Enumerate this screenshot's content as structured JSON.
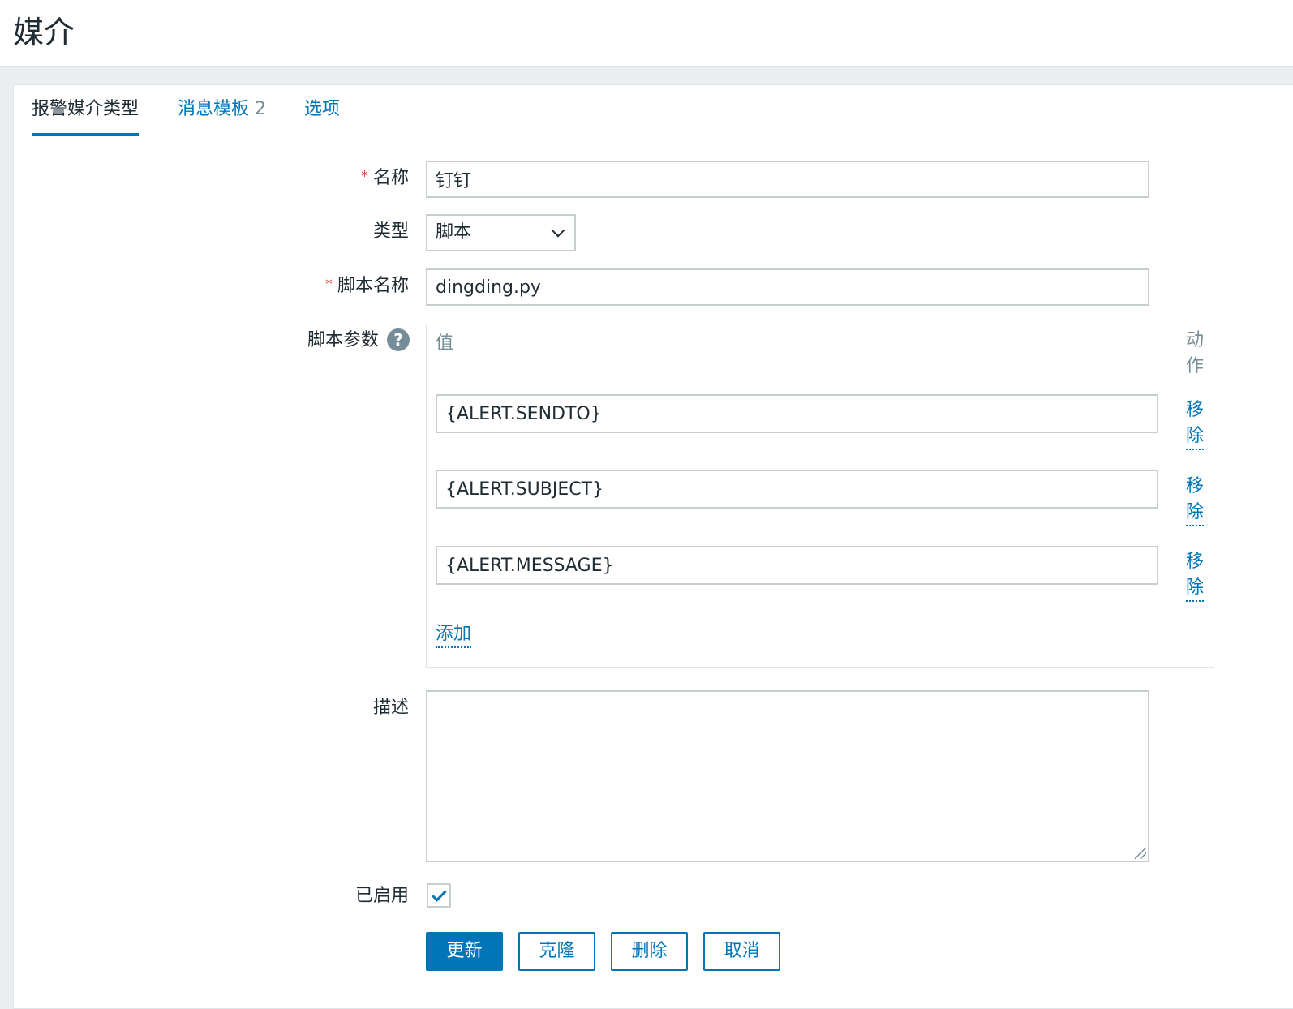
{
  "page": {
    "title": "媒介"
  },
  "tabs": [
    {
      "label": "报警媒介类型",
      "count": ""
    },
    {
      "label": "消息模板",
      "count": "2"
    },
    {
      "label": "选项",
      "count": ""
    }
  ],
  "form": {
    "name": {
      "label": "名称",
      "value": "钉钉"
    },
    "type": {
      "label": "类型",
      "value": "脚本"
    },
    "script_name": {
      "label": "脚本名称",
      "value": "dingding.py"
    },
    "script_params": {
      "label": "脚本参数",
      "help": "?",
      "col_value": "值",
      "col_action": [
        "动",
        "作"
      ],
      "rows": [
        {
          "value": "{ALERT.SENDTO}",
          "remove": [
            "移",
            "除"
          ]
        },
        {
          "value": "{ALERT.SUBJECT}",
          "remove": [
            "移",
            "除"
          ]
        },
        {
          "value": "{ALERT.MESSAGE}",
          "remove": [
            "移",
            "除"
          ]
        }
      ],
      "add_label": "添加"
    },
    "description": {
      "label": "描述",
      "value": ""
    },
    "enabled": {
      "label": "已启用",
      "checked": true
    }
  },
  "buttons": {
    "update": "更新",
    "clone": "克隆",
    "delete": "删除",
    "cancel": "取消"
  },
  "colors": {
    "accent": "#0275b8",
    "required": "#d64e4e",
    "muted": "#768d99"
  }
}
